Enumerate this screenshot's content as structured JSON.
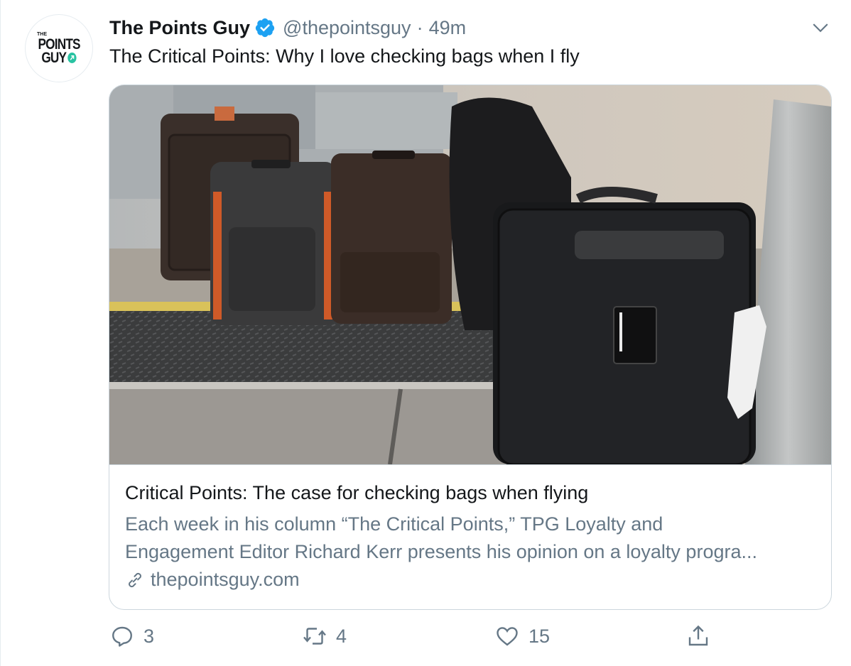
{
  "tweet": {
    "author_name": "The Points Guy",
    "handle": "@thepointsguy",
    "separator": "·",
    "time": "49m",
    "text": "The Critical Points: Why I love checking bags when I fly",
    "avatar": {
      "small_text": "THE",
      "line1": "POINTS",
      "line2": "GUY"
    },
    "verified_icon": "verified-badge-icon",
    "accent_color": "#1da1f2"
  },
  "card": {
    "image_alt": "Several suitcases standing at an airport baggage carousel",
    "title": "Critical Points: The case for checking bags when flying",
    "description_line1": "Each week in his column “The Critical Points,” TPG Loyalty and",
    "description_line2": "Engagement Editor Richard Kerr presents his opinion on a loyalty progra...",
    "domain": "thepointsguy.com",
    "link_icon": "link-icon"
  },
  "actions": {
    "reply_count": "3",
    "retweet_count": "4",
    "like_count": "15",
    "icons": [
      "reply-icon",
      "retweet-icon",
      "like-icon",
      "share-icon"
    ]
  }
}
